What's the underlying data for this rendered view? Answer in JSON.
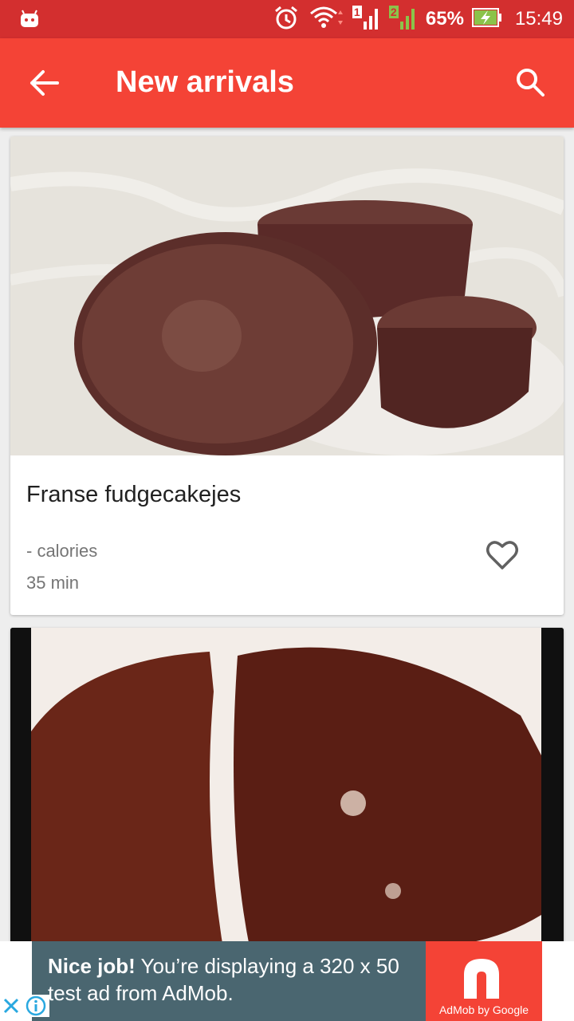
{
  "status_bar": {
    "battery_percent": "65%",
    "time": "15:49",
    "sim1": "1",
    "sim2": "2",
    "icons": [
      "android-icon",
      "alarm-icon",
      "wifi-icon",
      "signal-sim1-icon",
      "signal-sim2-icon",
      "battery-charging-icon"
    ]
  },
  "app_bar": {
    "title": "New arrivals",
    "back_icon": "arrow-left-icon",
    "search_icon": "search-icon",
    "color": "#f44336"
  },
  "recipes": [
    {
      "title": "Franse fudgecakejes",
      "calories": "- calories",
      "duration": "35 min",
      "favorite_icon": "heart-outline-icon"
    },
    {
      "title": "",
      "calories": "",
      "duration": ""
    }
  ],
  "ad": {
    "headline": "Nice job!",
    "body": " You’re displaying a 320 x 50 test ad from AdMob.",
    "brand": "AdMob by Google",
    "icons": [
      "close-icon",
      "info-icon"
    ]
  }
}
